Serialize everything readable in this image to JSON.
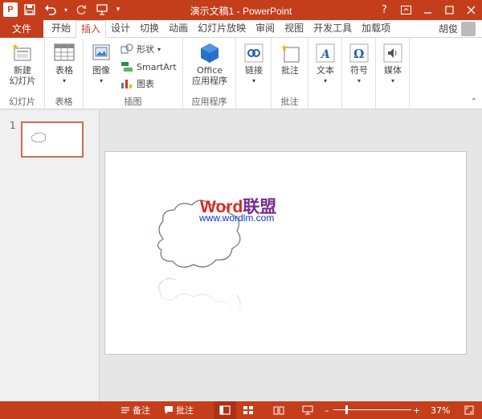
{
  "titlebar": {
    "app_logo": "P",
    "title": "演示文稿1 - PowerPoint",
    "help": "?"
  },
  "tabs": {
    "file": "文件",
    "items": [
      "开始",
      "插入",
      "设计",
      "切换",
      "动画",
      "幻灯片放映",
      "审阅",
      "视图",
      "开发工具",
      "加载项"
    ],
    "active_index": 1,
    "user": "胡俊"
  },
  "ribbon": {
    "groups": {
      "slides": {
        "label": "幻灯片",
        "new_slide": "新建\n幻灯片"
      },
      "tables": {
        "label": "表格",
        "table": "表格"
      },
      "images": {
        "label": "插图",
        "image": "图像",
        "shapes": "形状",
        "smartart": "SmartArt",
        "chart": "图表"
      },
      "apps": {
        "label": "应用程序",
        "office_apps": "Office\n应用程序"
      },
      "links": {
        "label": "",
        "link": "链接"
      },
      "comments": {
        "label": "批注",
        "comment": "批注"
      },
      "text": {
        "label": "",
        "text": "文本"
      },
      "symbols": {
        "label": "",
        "symbol": "符号"
      },
      "media": {
        "label": "",
        "media": "媒体"
      }
    }
  },
  "thumbnails": {
    "number": "1"
  },
  "slide": {
    "wm_word": "Word",
    "wm_lianmeng": "联盟",
    "wm_url": "www.wordlm.com"
  },
  "statusbar": {
    "notes": "备注",
    "comments": "批注",
    "zoom": "37%"
  },
  "colors": {
    "accent": "#c43e1c",
    "wm_red": "#e0241b",
    "wm_green": "#2e9a3a",
    "wm_purple": "#7a2a8c",
    "wm_url": "#0a36c9"
  }
}
